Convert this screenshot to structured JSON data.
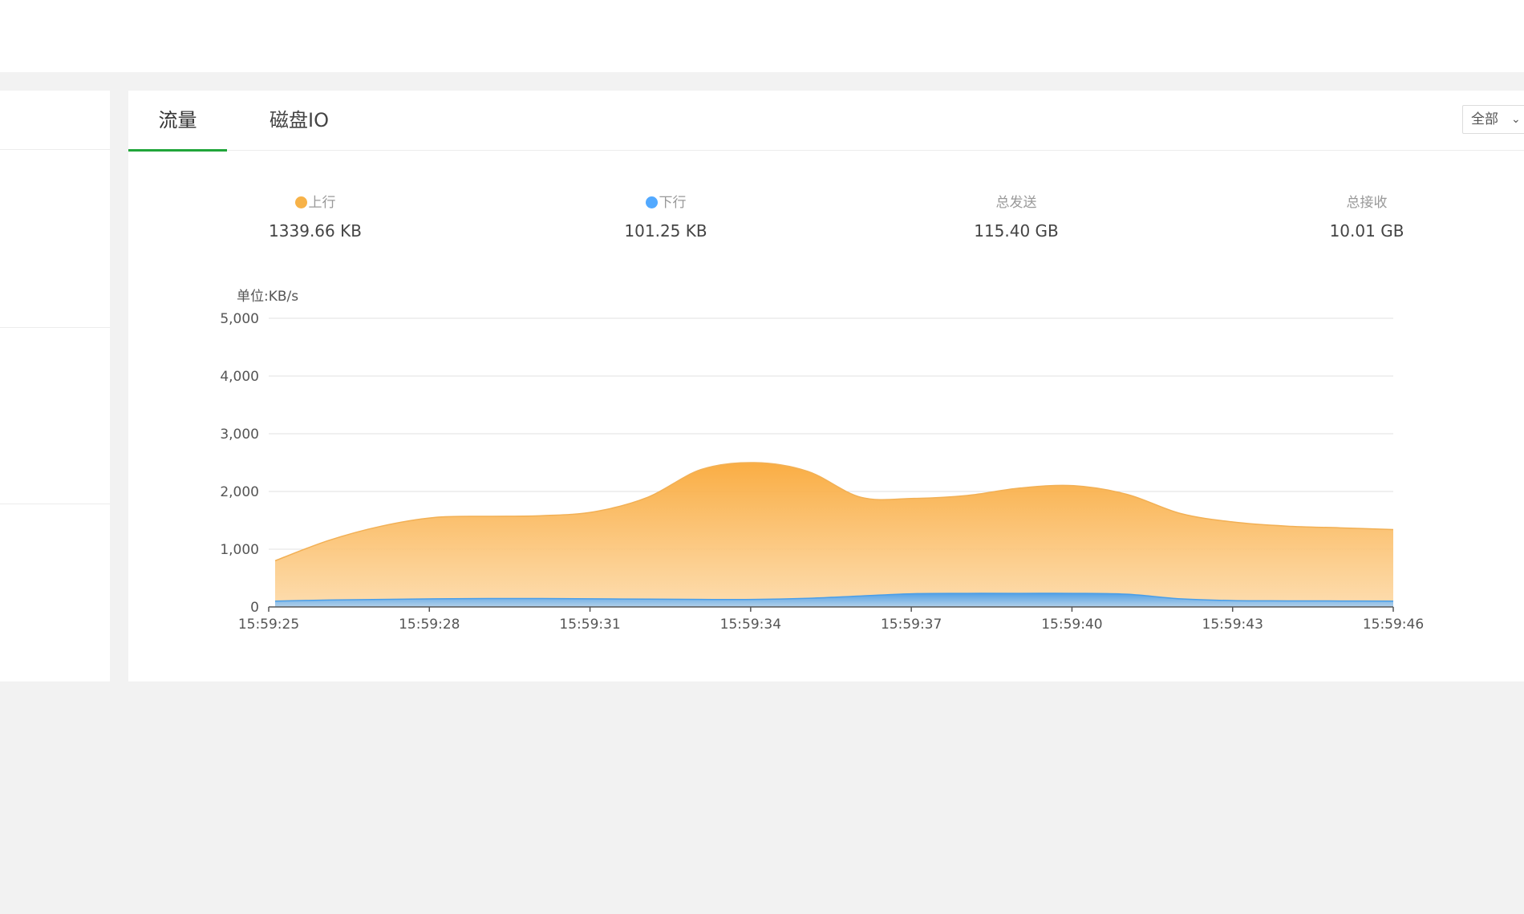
{
  "tabs": [
    {
      "label": "流量",
      "active": true
    },
    {
      "label": "磁盘IO",
      "active": false
    }
  ],
  "select": {
    "value": "全部"
  },
  "stats": [
    {
      "label": "上行",
      "value": "1339.66 KB",
      "dot_color": "#f7b248"
    },
    {
      "label": "下行",
      "value": "101.25 KB",
      "dot_color": "#52a9ff"
    },
    {
      "label": "总发送",
      "value": "115.40 GB"
    },
    {
      "label": "总接收",
      "value": "10.01 GB"
    }
  ],
  "chart_data": {
    "type": "area",
    "ylabel": "单位:KB/s",
    "ylim": [
      0,
      5000
    ],
    "yticks": [
      "0",
      "1,000",
      "2,000",
      "3,000",
      "4,000",
      "5,000"
    ],
    "yticks_values": [
      0,
      1000,
      2000,
      3000,
      4000,
      5000
    ],
    "xticks": [
      "15:59:25",
      "15:59:28",
      "15:59:31",
      "15:59:34",
      "15:59:37",
      "15:59:40",
      "15:59:43",
      "15:59:46"
    ],
    "x": [
      "15:59:25",
      "15:59:26",
      "15:59:27",
      "15:59:28",
      "15:59:29",
      "15:59:30",
      "15:59:31",
      "15:59:32",
      "15:59:33",
      "15:59:34",
      "15:59:35",
      "15:59:36",
      "15:59:37",
      "15:59:38",
      "15:59:39",
      "15:59:40",
      "15:59:41",
      "15:59:42",
      "15:59:43",
      "15:59:44",
      "15:59:45",
      "15:59:46"
    ],
    "series": [
      {
        "name": "上行",
        "color": "#f7b248",
        "values": [
          800,
          1150,
          1400,
          1550,
          1570,
          1580,
          1650,
          1900,
          2380,
          2500,
          2350,
          1900,
          1880,
          1930,
          2060,
          2100,
          1950,
          1620,
          1470,
          1400,
          1370,
          1340
        ]
      },
      {
        "name": "下行",
        "color": "#52a9ff",
        "values": [
          100,
          120,
          130,
          140,
          145,
          145,
          140,
          135,
          130,
          130,
          150,
          190,
          230,
          235,
          235,
          235,
          220,
          140,
          110,
          105,
          103,
          101
        ]
      }
    ],
    "grid": true,
    "legend": "top"
  }
}
